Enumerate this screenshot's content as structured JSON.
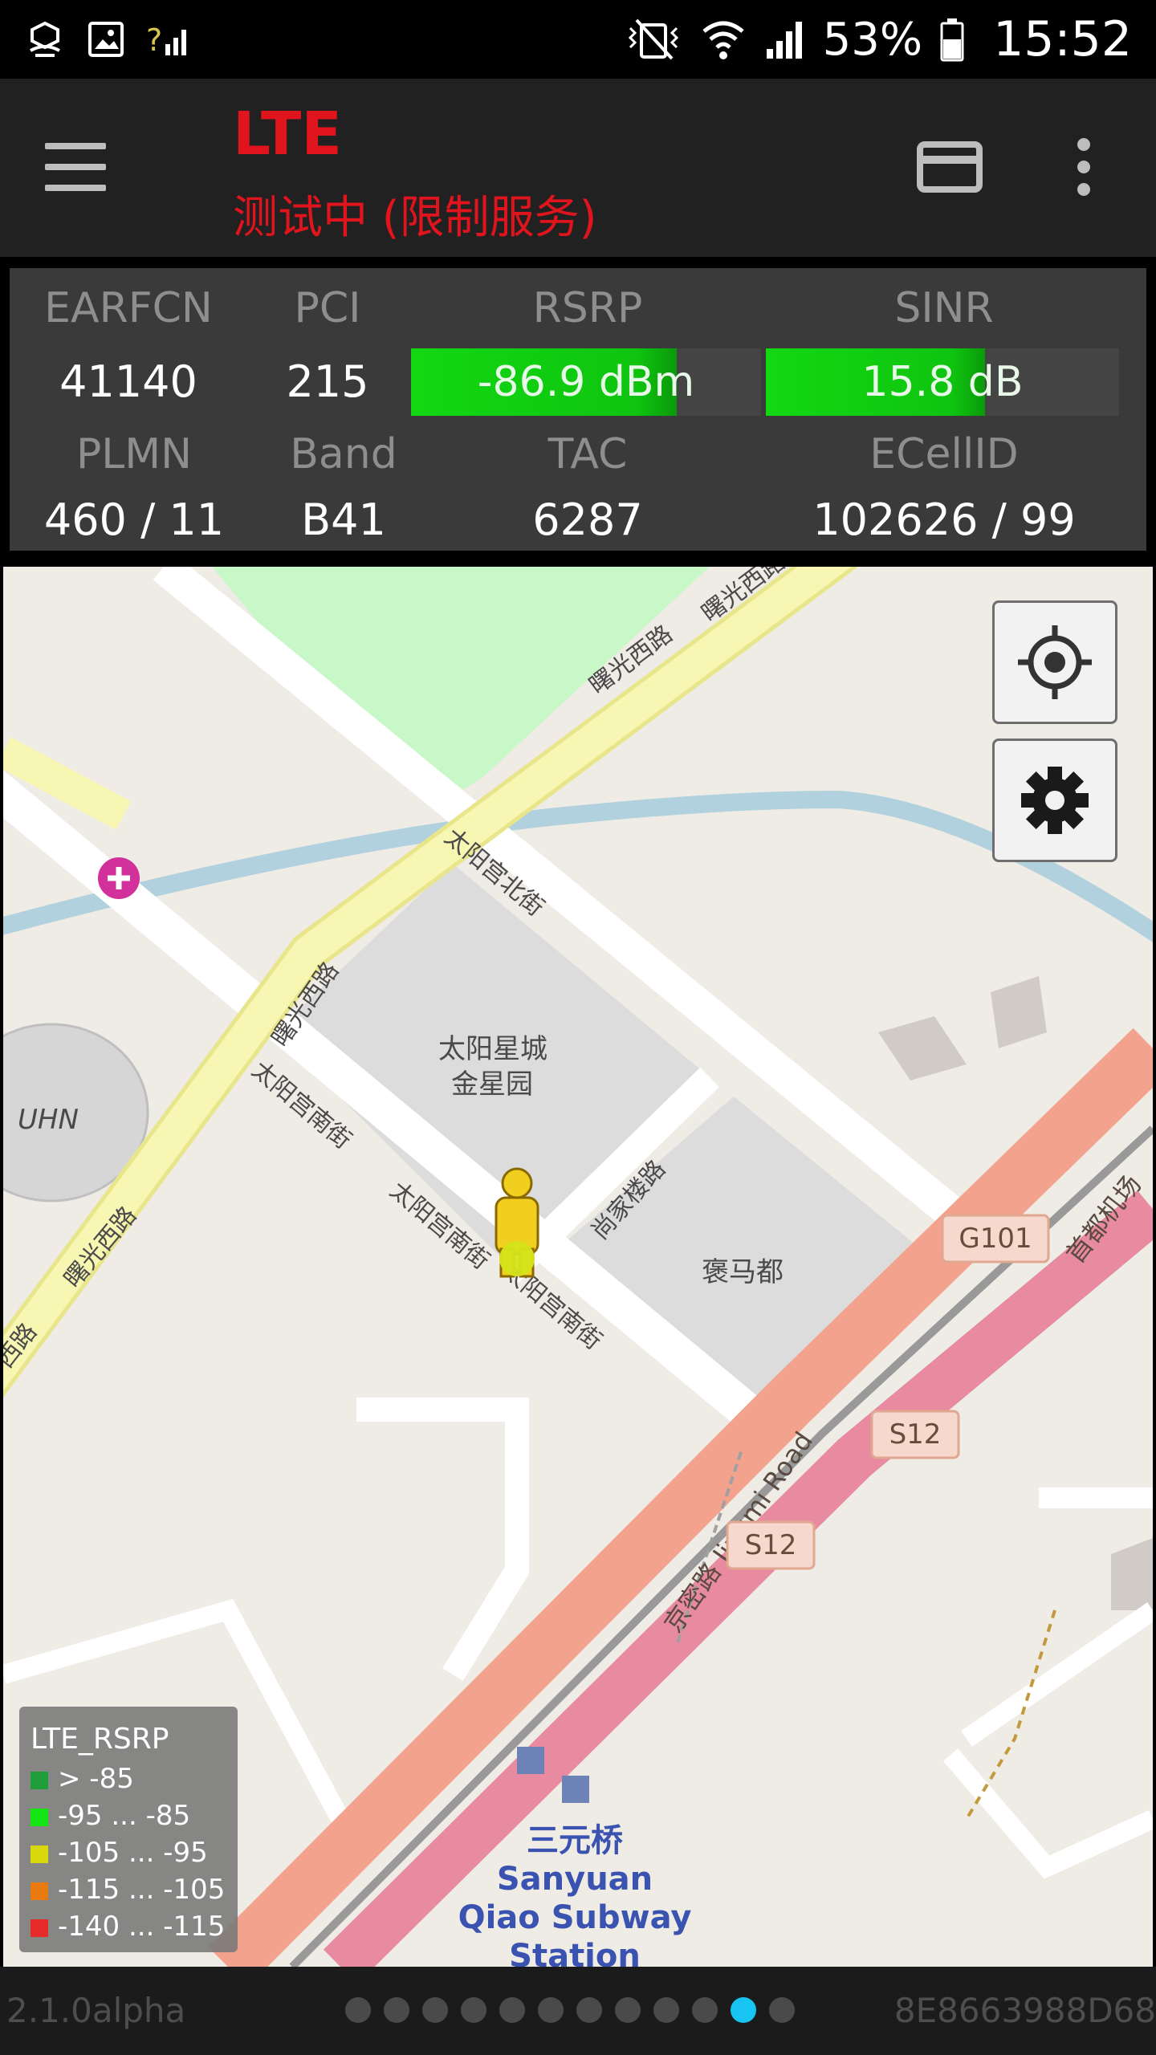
{
  "status_bar": {
    "battery_percent": "53%",
    "time": "15:52",
    "icons": [
      "cast-icon",
      "image-icon",
      "signal-unknown-icon",
      "mute-icon",
      "wifi-icon",
      "cell-signal-icon",
      "battery-icon"
    ]
  },
  "app_bar": {
    "title": "LTE",
    "subtitle": "测试中 (限制服务)",
    "icons": [
      "menu-icon",
      "card-icon",
      "more-icon"
    ],
    "title_color": "#e0141c"
  },
  "info": {
    "earfcn": {
      "label": "EARFCN",
      "value": "41140"
    },
    "pci": {
      "label": "PCI",
      "value": "215"
    },
    "rsrp": {
      "label": "RSRP",
      "value": "-86.9 dBm",
      "level": 0.76
    },
    "sinr": {
      "label": "SINR",
      "value": "15.8 dB",
      "level": 0.62
    },
    "plmn": {
      "label": "PLMN",
      "value": "460 / 11"
    },
    "band": {
      "label": "Band",
      "value": "B41"
    },
    "tac": {
      "label": "TAC",
      "value": "6287"
    },
    "ecellid": {
      "label": "ECellID",
      "value": "102626 / 99"
    },
    "meter_color": "#12d812"
  },
  "map": {
    "labels": {
      "road_shuguang_ne1": "曙光西路",
      "road_shuguang_ne2": "曙光西路",
      "road_shuguang_mid": "曙光西路",
      "road_shuguang_sw1": "曙光西路",
      "road_shuguang_sw2": "西路",
      "road_taiyanggong_bei": "太阳宫北街",
      "road_taiyanggong_nan1": "太阳宫南街",
      "road_taiyanggong_nan2": "太阳宫南街",
      "road_taiyanggong_nan3": "太阳宫南街",
      "road_shangjia": "尚家楼路",
      "block_taiyangxingcheng_1": "太阳星城",
      "block_taiyangxingcheng_2": "金星园",
      "block_baomadu": "褒马都",
      "uhn": "UHN",
      "road_jingmi": "京密路 Jingmi Road",
      "road_airport": "首都机场",
      "shield_g101": "G101",
      "shield_s12_a": "S12",
      "shield_s12_b": "S12",
      "station_cn": "三元桥",
      "station_en1": "Sanyuan",
      "station_en2": "Qiao Subway",
      "station_en3": "Station"
    },
    "buttons": [
      "my-location-icon",
      "settings-icon"
    ]
  },
  "legend": {
    "title": "LTE_RSRP",
    "items": [
      {
        "label": "> -85",
        "color": "#1f9d3a"
      },
      {
        "label": "-95 ... -85",
        "color": "#13e613"
      },
      {
        "label": "-105 ... -95",
        "color": "#d8d80c"
      },
      {
        "label": "-115 ... -105",
        "color": "#e87a10"
      },
      {
        "label": "-140 ... -115",
        "color": "#e62a2a"
      }
    ]
  },
  "footer": {
    "version": "2.1.0alpha",
    "device_id": "8E8663988D68",
    "page_count": 12,
    "active_page": 11,
    "active_color": "#18c5f2"
  }
}
